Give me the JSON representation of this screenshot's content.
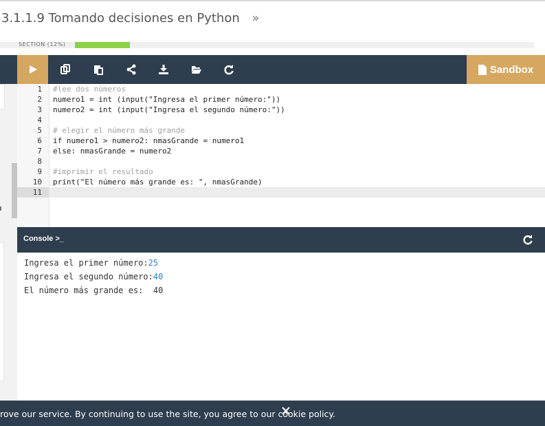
{
  "header": {
    "title": "3.1.1.9 Tomando decisiones en Python",
    "next_symbol": "»"
  },
  "section": {
    "label": "SECTION (12%)",
    "progress": 0.12,
    "color": "#8bd14a"
  },
  "toolbar": {
    "icons": [
      "play-icon",
      "copy-icon",
      "paste-icon",
      "share-icon",
      "download-icon",
      "folder-open-icon",
      "refresh-icon"
    ],
    "sandbox_label": "Sandbox",
    "accent_color": "#d5a761",
    "bar_color": "#2e3e4e"
  },
  "editor": {
    "line_numbers": [
      "1",
      "2",
      "3",
      "4",
      "5",
      "6",
      "7",
      "8",
      "9",
      "10",
      "11"
    ],
    "lines": [
      "#lee dos números",
      "numero1 = int (input(\"Ingresa el primer número:\"))",
      "numero2 = int (input(\"Ingresa el segundo número:\"))",
      "",
      "# elegir el número más grande",
      "if numero1 > numero2: nmasGrande = numero1",
      "else: nmasGrande = numero2",
      "",
      "#imprimir el resultado",
      "print(\"El número más grande es: \", nmasGrande)",
      ""
    ]
  },
  "console": {
    "label": "Console >_",
    "output": [
      {
        "prompt": "Ingresa el primer número:",
        "input": "25"
      },
      {
        "prompt": "Ingresa el segundo número:",
        "input": "40"
      },
      {
        "prompt": "El número más grande es:  40",
        "input": ""
      }
    ]
  },
  "cookie_banner": {
    "text": "rove our service. By continuing to use the site, you agree to our cookie policy.",
    "close_symbol": "✕"
  }
}
